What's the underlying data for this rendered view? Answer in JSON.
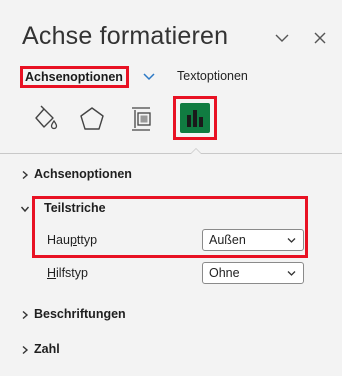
{
  "header": {
    "title": "Achse formatieren"
  },
  "options": {
    "axis_options_label": "Achsenoptionen",
    "text_options_label": "Textoptionen"
  },
  "icons": {
    "fill_line": "fill-line-icon",
    "effects": "effects-icon",
    "size_properties": "size-properties-icon",
    "axis_options": "axis-options-icon"
  },
  "sections": {
    "axis_options": "Achsenoptionen",
    "tick_marks": "Teilstriche",
    "labels": "Beschriftungen",
    "number": "Zahl"
  },
  "tick_marks": {
    "major": {
      "label_pre": "Hau",
      "label_u": "p",
      "label_post": "ttyp",
      "value": "Außen"
    },
    "minor": {
      "label_u": "H",
      "label_post": "ilfstyp",
      "value": "Ohne"
    }
  },
  "colors": {
    "highlight": "#e81123",
    "accent_green": "#107c41",
    "chevron_blue": "#2b78c5"
  }
}
